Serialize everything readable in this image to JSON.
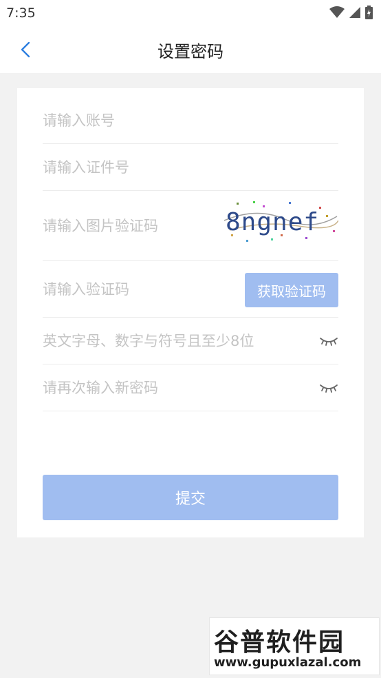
{
  "status_bar": {
    "time": "7:35"
  },
  "header": {
    "title": "设置密码"
  },
  "form": {
    "account_placeholder": "请输入账号",
    "id_placeholder": "请输入证件号",
    "captcha_placeholder": "请输入图片验证码",
    "captcha_text": "8ngnef",
    "sms_placeholder": "请输入验证码",
    "get_code_label": "获取验证码",
    "password_placeholder": "英文字母、数字与符号且至少8位",
    "confirm_placeholder": "请再次输入新密码",
    "submit_label": "提交"
  },
  "watermark": {
    "brand": "谷普软件园",
    "url": "www.gupuxlazal.com"
  },
  "colors": {
    "accent": "#2f7fe0",
    "button": "#a0bdf0",
    "placeholder": "#c4c4c4",
    "background": "#f2f2f2"
  }
}
